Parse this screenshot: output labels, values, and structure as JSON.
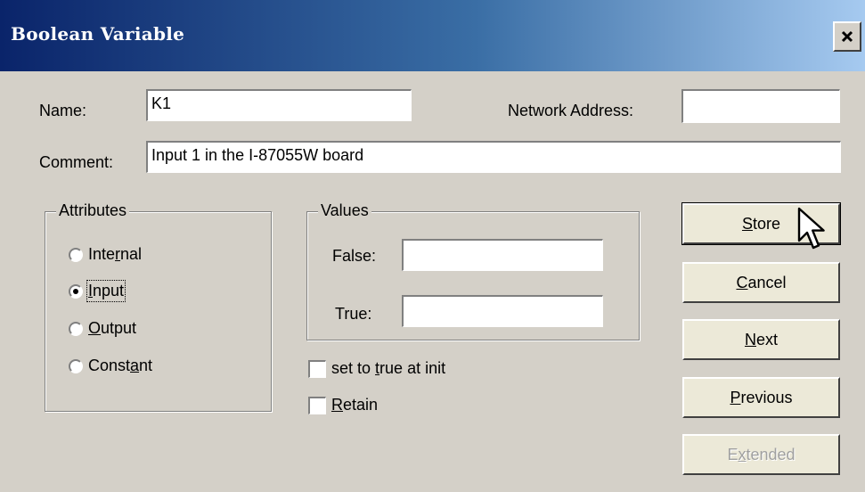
{
  "window": {
    "title": "Boolean Variable",
    "close_symbol": "×"
  },
  "form": {
    "name_label": "Name:",
    "name_value": "K1",
    "network_address_label": "Network Address:",
    "network_address_value": "",
    "comment_label": "Comment:",
    "comment_value": "Input 1 in the I-87055W board"
  },
  "attributes": {
    "legend": "Attributes",
    "options": [
      {
        "pre": "Inte",
        "key": "r",
        "post": "nal",
        "selected": false
      },
      {
        "pre": "",
        "key": "I",
        "post": "nput",
        "selected": true
      },
      {
        "pre": "",
        "key": "O",
        "post": "utput",
        "selected": false
      },
      {
        "pre": "Const",
        "key": "a",
        "post": "nt",
        "selected": false
      }
    ]
  },
  "values": {
    "legend": "Values",
    "false_label": "False:",
    "false_value": "",
    "true_label": "True:",
    "true_value": ""
  },
  "checkboxes": {
    "set_true": {
      "pre": "set to ",
      "key": "t",
      "post": "rue at init",
      "checked": false
    },
    "retain": {
      "pre": "",
      "key": "R",
      "post": "etain",
      "checked": false
    }
  },
  "buttons": {
    "store": {
      "pre": "",
      "key": "S",
      "post": "tore"
    },
    "cancel": {
      "pre": "",
      "key": "C",
      "post": "ancel"
    },
    "next": {
      "pre": "",
      "key": "N",
      "post": "ext"
    },
    "previous": {
      "pre": "",
      "key": "P",
      "post": "revious"
    },
    "extended": {
      "pre": "E",
      "key": "x",
      "post": "tended",
      "disabled": true
    }
  },
  "icons": {
    "close": "close-icon",
    "radio": "radio-icon",
    "checkbox": "checkbox-icon",
    "cursor": "mouse-pointer-icon"
  },
  "colors": {
    "titlebar_start": "#0a246a",
    "titlebar_end": "#a6caf0",
    "dialog_bg": "#d4d0c8"
  }
}
